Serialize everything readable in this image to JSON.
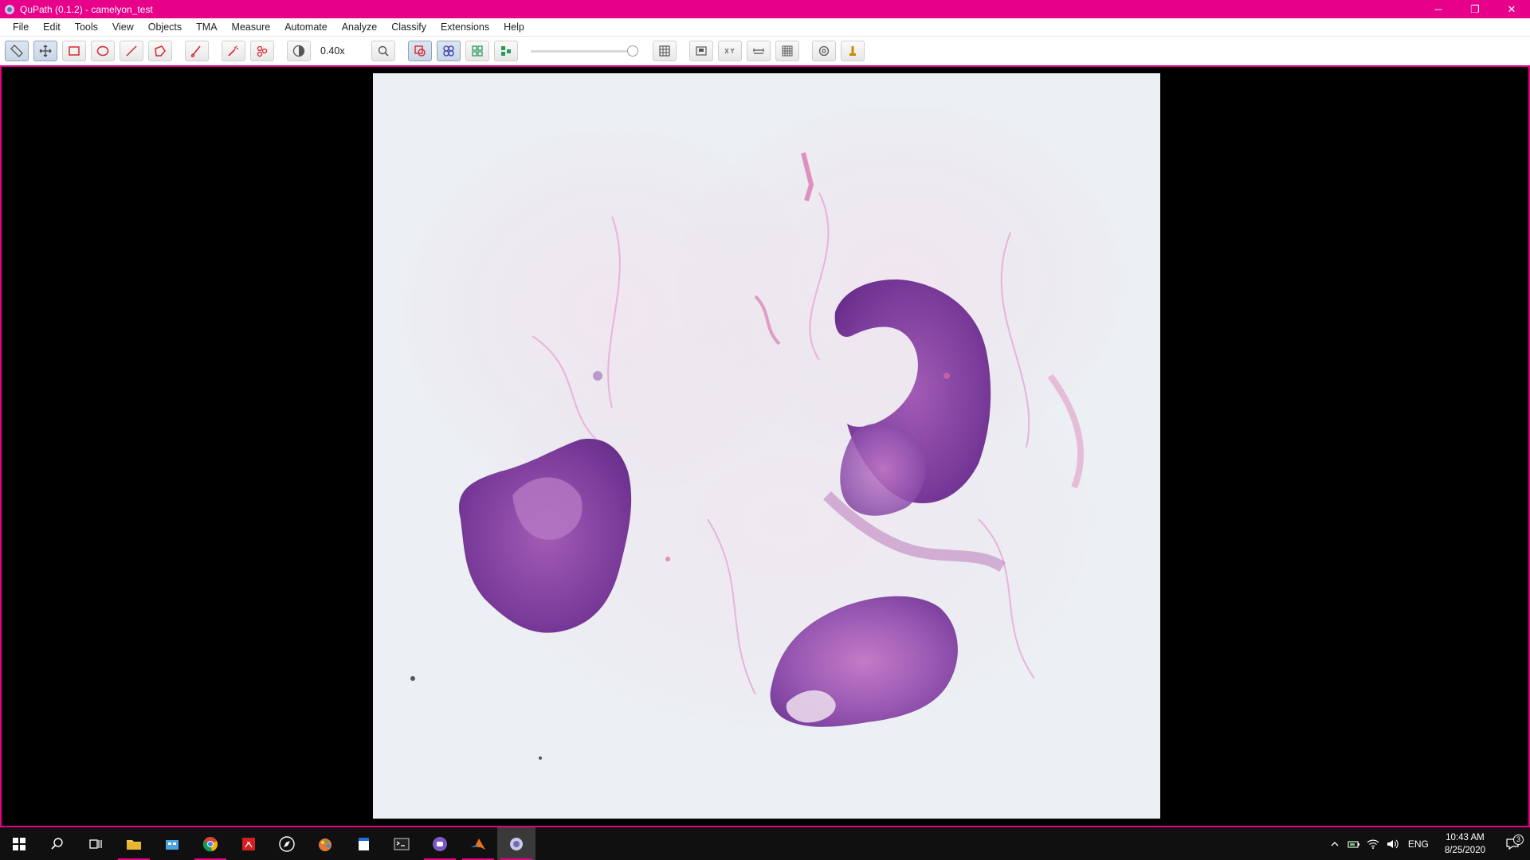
{
  "window": {
    "title": "QuPath (0.1.2) - camelyon_test",
    "minimize": "─",
    "restore": "❐",
    "close": "✕"
  },
  "menu": [
    "File",
    "Edit",
    "Tools",
    "View",
    "Objects",
    "TMA",
    "Measure",
    "Automate",
    "Analyze",
    "Classify",
    "Extensions",
    "Help"
  ],
  "toolbar": {
    "zoom_level": "0.40x",
    "zoom_slider_level": 1.0,
    "accent": "#e6008a"
  },
  "taskbar": {
    "time": "10:43 AM",
    "date": "8/25/2020",
    "language": "ENG",
    "notifications": "3"
  }
}
